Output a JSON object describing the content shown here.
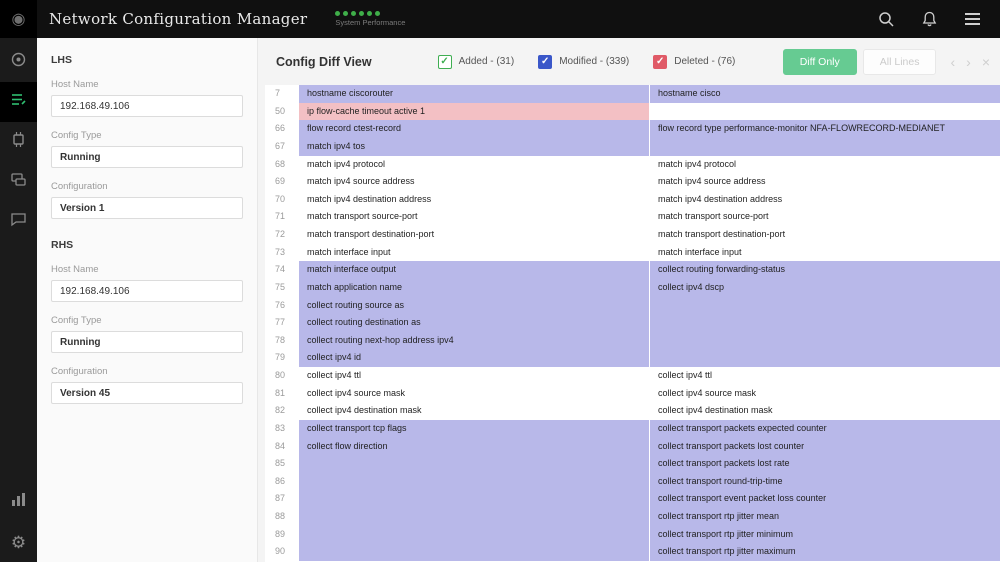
{
  "app": {
    "title": "Network Configuration Manager",
    "subtitle": "System Performance",
    "status_dots": 6
  },
  "topbar_icons": [
    "search-icon",
    "bell-icon",
    "menu-icon"
  ],
  "sidebar_icons": [
    "home-icon",
    "config-list-icon",
    "firmware-icon",
    "devices-icon",
    "chat-icon",
    "reports-icon",
    "settings-icon"
  ],
  "panel": {
    "lhs_label": "LHS",
    "rhs_label": "RHS",
    "host_name_label": "Host Name",
    "config_type_label": "Config Type",
    "configuration_label": "Configuration",
    "lhs": {
      "host_name": "192.168.49.106",
      "config_type": "Running",
      "configuration": "Version 1"
    },
    "rhs": {
      "host_name": "192.168.49.106",
      "config_type": "Running",
      "configuration": "Version 45"
    }
  },
  "diff": {
    "title": "Config Diff View",
    "legend": [
      {
        "key": "added",
        "label": "Added - (31)",
        "color": "#3fae52",
        "fill": false
      },
      {
        "key": "modified",
        "label": "Modified - (339)",
        "color": "#3a57c9",
        "fill": true
      },
      {
        "key": "deleted",
        "label": "Deleted - (76)",
        "color": "#e05a67",
        "fill": true
      }
    ],
    "diff_only_label": "Diff Only",
    "all_lines_label": "All Lines",
    "colors": {
      "modified_row": "#b8b8e9",
      "deleted_row": "#f3c0c4",
      "diff_only_button": "#66cb92"
    },
    "rows": [
      {
        "num": "7",
        "left": "hostname ciscorouter",
        "right": "hostname cisco",
        "type": "modified"
      },
      {
        "num": "50",
        "left": "ip flow-cache timeout active 1",
        "right": "",
        "type": "deleted"
      },
      {
        "num": "66",
        "left": "flow record ctest-record",
        "right": "flow record type performance-monitor NFA-FLOWRECORD-MEDIANET",
        "type": "modified"
      },
      {
        "num": "67",
        "left": "match ipv4 tos",
        "right": "",
        "type": "modified"
      },
      {
        "num": "68",
        "left": "match ipv4 protocol",
        "right": "match ipv4 protocol",
        "type": "same"
      },
      {
        "num": "69",
        "left": "match ipv4 source address",
        "right": "match ipv4 source address",
        "type": "same"
      },
      {
        "num": "70",
        "left": "match ipv4 destination address",
        "right": "match ipv4 destination address",
        "type": "same"
      },
      {
        "num": "71",
        "left": "match transport source-port",
        "right": "match transport source-port",
        "type": "same"
      },
      {
        "num": "72",
        "left": "match transport destination-port",
        "right": "match transport destination-port",
        "type": "same"
      },
      {
        "num": "73",
        "left": "match interface input",
        "right": "match interface input",
        "type": "same"
      },
      {
        "num": "74",
        "left": "match interface output",
        "right": "collect routing forwarding-status",
        "type": "modified"
      },
      {
        "num": "75",
        "left": "match application name",
        "right": "collect ipv4 dscp",
        "type": "modified"
      },
      {
        "num": "76",
        "left": "collect routing source as",
        "right": "",
        "type": "modified"
      },
      {
        "num": "77",
        "left": "collect routing destination as",
        "right": "",
        "type": "modified"
      },
      {
        "num": "78",
        "left": "collect routing next-hop address ipv4",
        "right": "",
        "type": "modified"
      },
      {
        "num": "79",
        "left": "collect ipv4 id",
        "right": "",
        "type": "modified"
      },
      {
        "num": "80",
        "left": "collect ipv4 ttl",
        "right": "collect ipv4 ttl",
        "type": "same"
      },
      {
        "num": "81",
        "left": "collect ipv4 source mask",
        "right": "collect ipv4 source mask",
        "type": "same"
      },
      {
        "num": "82",
        "left": "collect ipv4 destination mask",
        "right": "collect ipv4 destination mask",
        "type": "same"
      },
      {
        "num": "83",
        "left": "collect transport tcp flags",
        "right": "collect transport packets expected counter",
        "type": "modified"
      },
      {
        "num": "84",
        "left": "collect flow direction",
        "right": "collect transport packets lost counter",
        "type": "modified"
      },
      {
        "num": "85",
        "left": "",
        "right": "collect transport packets lost rate",
        "type": "modified"
      },
      {
        "num": "86",
        "left": "",
        "right": "collect transport round-trip-time",
        "type": "modified"
      },
      {
        "num": "87",
        "left": "",
        "right": "collect transport event packet loss counter",
        "type": "modified"
      },
      {
        "num": "88",
        "left": "",
        "right": "collect transport rtp jitter mean",
        "type": "modified"
      },
      {
        "num": "89",
        "left": "",
        "right": "collect transport rtp jitter minimum",
        "type": "modified"
      },
      {
        "num": "90",
        "left": "",
        "right": "collect transport rtp jitter maximum",
        "type": "modified"
      }
    ]
  }
}
